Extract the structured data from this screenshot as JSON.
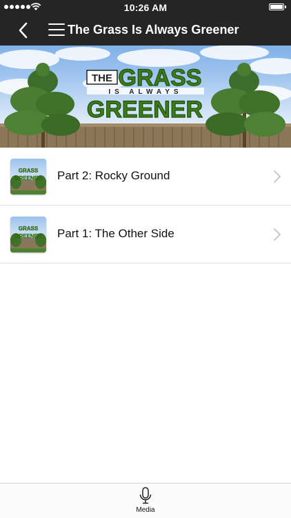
{
  "status_bar": {
    "time": "10:26 AM"
  },
  "nav": {
    "title": "The Grass Is Always Greener"
  },
  "banner": {
    "line1_small": "THE",
    "line1_big": "GRASS",
    "line2": "IS ALWAYS",
    "line3": "GREENER"
  },
  "episodes": [
    {
      "title": "Part 2: Rocky Ground",
      "thumb_text": "GRASS GREENER"
    },
    {
      "title": "Part 1: The Other Side",
      "thumb_text": "GRASS GREENER"
    }
  ],
  "tab_bar": {
    "media_label": "Media"
  },
  "colors": {
    "bar_background": "#252525",
    "grass_green": "#3c7d1a",
    "separator": "#dedede"
  }
}
